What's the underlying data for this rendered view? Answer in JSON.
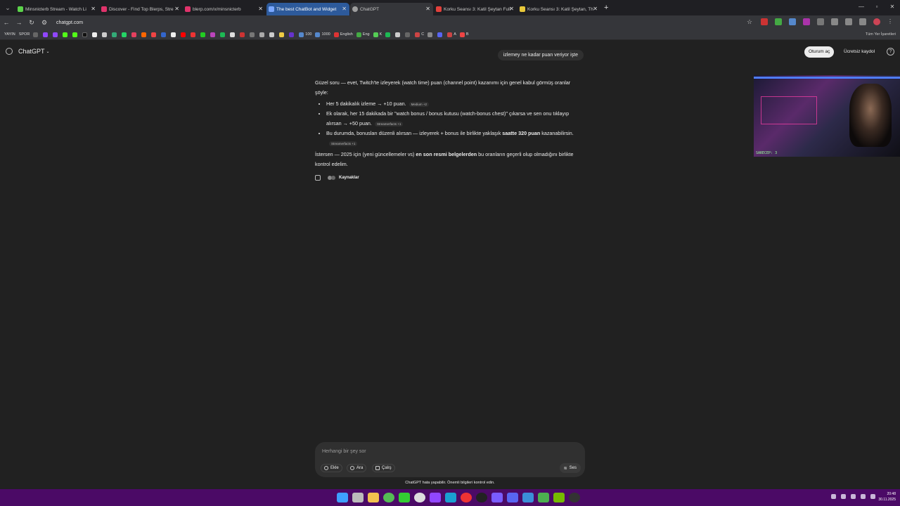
{
  "browser": {
    "tabs": [
      {
        "title": "Minsnicterb Stream - Watch Li",
        "color": "#5bd34a"
      },
      {
        "title": "Discover - Find Top Blerps, Stre",
        "color": "#e0336b"
      },
      {
        "title": "blerp.com/x/minsnicterb",
        "color": "#e0336b"
      },
      {
        "title": "The best ChatBot and Widget",
        "color": "#7aa7ff"
      },
      {
        "title": "ChatGPT",
        "color": "#9e9e9e"
      },
      {
        "title": "Korku Seansı 3: Katil Şeytan Full",
        "color": "#e2403b"
      },
      {
        "title": "Korku Seansı 3: Katil Şeytan, Th",
        "color": "#e8c83a"
      }
    ],
    "url": "chatgpt.com",
    "bookmarks_left": [
      "YAYIN",
      "SPOR"
    ],
    "bookmarks_items": [
      "100",
      "1000",
      "English",
      "Eng",
      "K",
      "C",
      "A",
      "B"
    ],
    "bookmarks_right": "Tüm Yer İşaretleri"
  },
  "app": {
    "brand": "ChatGPT",
    "login_label": "Oturum aç",
    "signup_label": "Ücretsiz kaydol",
    "help_label": "?"
  },
  "conversation": {
    "user_message": "izlemey ne kadar puan veriyor işte",
    "answer": {
      "intro": "Güzel soru — evet, Twitch'te izleyerek (watch time) puan (channel point) kazanımı için genel kabul görmüş oranlar şöyle:",
      "bullets": [
        {
          "text": "Her 5 dakikalık izleme → +10 puan.",
          "chip": "Medium +2"
        },
        {
          "text": "Ek olarak, her 15 dakikada bir \"watch bonus / bonus kutusu (watch-bonus chest)\" çıkarsa ve sen onu tıklayıp alırsan → +50 puan.",
          "chip": "Streamerfacts +1"
        },
        {
          "text_before": "Bu durumda, bonusları düzenli alırsan — izleyerek + bonus ile birlikte yaklaşık ",
          "text_bold": "saatte 320 puan",
          "text_after": " kazanabilirsin.",
          "chip": "Streamerfacts +1"
        }
      ],
      "outro_before": "İstersen — 2025 için (yeni güncellemeler vs) ",
      "outro_bold": "en son resmi belgelerden",
      "outro_after": " bu oranların geçerli olup olmadığını birlikte kontrol edelim."
    },
    "sources_label": "Kaynaklar"
  },
  "webcam": {
    "caption": "SARECEP: 3"
  },
  "composer": {
    "placeholder": "Herhangi bir şey sor",
    "attach_label": "Ekle",
    "search_label": "Ara",
    "study_label": "Çalış",
    "voice_label": "Ses"
  },
  "disclaimer": "ChatGPT hata yapabilir. Önemli bilgileri kontrol edin.",
  "taskbar": {
    "time": "20:48",
    "date": "30.11.2025"
  }
}
